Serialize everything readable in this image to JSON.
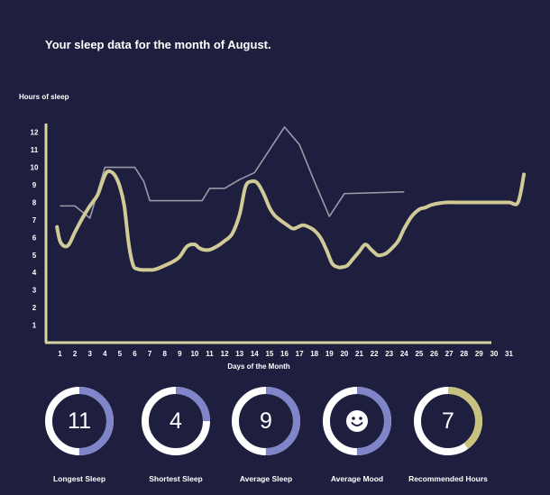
{
  "page": {
    "title": "Your sleep data for the month of August."
  },
  "colors": {
    "background": "#1e1e3f",
    "axis": "#d8d4a0",
    "primary_line": "#d0ca96",
    "secondary_line": "#9a9aa8",
    "ring_track": "#ffffff",
    "ring_blue": "#8085c9",
    "ring_gold": "#c9c27e"
  },
  "chart_data": {
    "type": "line",
    "ylabel": "Hours of sleep",
    "xlabel": "Days of the Month",
    "x_ticks": [
      1,
      2,
      3,
      4,
      5,
      6,
      7,
      8,
      9,
      10,
      11,
      12,
      13,
      14,
      15,
      16,
      17,
      18,
      19,
      20,
      21,
      22,
      23,
      24,
      25,
      26,
      27,
      28,
      29,
      30,
      31
    ],
    "y_ticks": [
      1,
      2,
      3,
      4,
      5,
      6,
      7,
      8,
      9,
      10,
      11,
      12
    ],
    "ylim": [
      0,
      12.5
    ],
    "grid": false,
    "legend": "none",
    "series": [
      {
        "style": "thick",
        "x": [
          0.8,
          1.0,
          1.3,
          1.6,
          2.0,
          2.5,
          3.0,
          3.5,
          3.8,
          4.1,
          4.4,
          4.7,
          5.0,
          5.3,
          5.6,
          5.9,
          6.2,
          6.5,
          6.8,
          7.2,
          7.6,
          8.0,
          8.5,
          9.0,
          9.5,
          10.0,
          10.3,
          10.6,
          11.0,
          11.5,
          12.0,
          12.5,
          13.0,
          13.4,
          13.8,
          14.2,
          14.6,
          15.0,
          15.3,
          15.7,
          16.2,
          16.6,
          17.2,
          17.6,
          18.0,
          18.4,
          18.8,
          19.2,
          19.6,
          19.8,
          20.2,
          20.6,
          21.0,
          21.4,
          21.8,
          22.2,
          22.5,
          22.8,
          23.2,
          23.6,
          24.0,
          24.5,
          25.0,
          25.4,
          25.8,
          26.3,
          26.8,
          27.5,
          28.0,
          29.0,
          30.0,
          31.0,
          31.6,
          32.0
        ],
        "values": [
          6.6,
          5.8,
          5.5,
          5.6,
          6.3,
          7.1,
          7.8,
          8.4,
          9.1,
          9.7,
          9.75,
          9.5,
          8.9,
          7.8,
          5.6,
          4.4,
          4.2,
          4.15,
          4.15,
          4.15,
          4.25,
          4.4,
          4.6,
          4.9,
          5.5,
          5.6,
          5.4,
          5.3,
          5.3,
          5.5,
          5.8,
          6.2,
          7.3,
          8.9,
          9.2,
          9.1,
          8.5,
          7.7,
          7.3,
          7.0,
          6.7,
          6.5,
          6.7,
          6.6,
          6.4,
          6.0,
          5.3,
          4.5,
          4.3,
          4.3,
          4.4,
          4.8,
          5.2,
          5.6,
          5.3,
          5.0,
          5.0,
          5.1,
          5.4,
          5.8,
          6.5,
          7.2,
          7.6,
          7.7,
          7.85,
          7.95,
          8.0,
          8.0,
          8.0,
          8.0,
          8.0,
          8.0,
          8.0,
          9.6
        ]
      },
      {
        "style": "thin",
        "x": [
          1,
          2,
          3,
          4,
          5,
          6,
          6.6,
          7,
          8,
          9,
          10,
          10.5,
          11,
          12,
          13,
          14,
          15,
          16,
          17,
          18,
          19,
          20,
          24
        ],
        "values": [
          7.8,
          7.8,
          7.1,
          10.0,
          10.0,
          10.0,
          9.2,
          8.1,
          8.1,
          8.1,
          8.1,
          8.1,
          8.8,
          8.8,
          9.3,
          9.7,
          11.0,
          12.3,
          11.3,
          9.2,
          7.2,
          8.5,
          8.6
        ]
      }
    ]
  },
  "stats": [
    {
      "label": "Longest Sleep",
      "value": "11",
      "progress": 0.5,
      "color": "blue",
      "icon": null
    },
    {
      "label": "Shortest Sleep",
      "value": "4",
      "progress": 0.25,
      "color": "blue",
      "icon": null
    },
    {
      "label": "Average Sleep",
      "value": "9",
      "progress": 0.5,
      "color": "blue",
      "icon": null
    },
    {
      "label": "Average Mood",
      "value": "",
      "progress": 0.5,
      "color": "blue",
      "icon": "smiley-face-icon"
    },
    {
      "label": "Recommended Hours",
      "value": "7",
      "progress": 0.4,
      "color": "gold",
      "icon": null
    }
  ]
}
